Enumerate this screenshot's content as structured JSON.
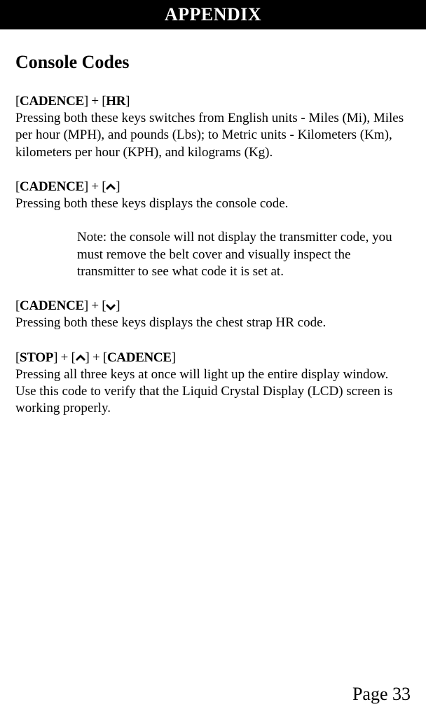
{
  "header": "APPENDIX",
  "sectionTitle": "Console Codes",
  "combos": [
    {
      "parts": [
        "[",
        "CADENCE",
        "] + [",
        "HR",
        "]"
      ],
      "boldIdx": [
        1,
        3
      ],
      "text": "Pressing both these keys switches from English units - Miles (Mi), Miles per hour (MPH), and pounds (Lbs); to Metric units - Kilometers (Km),  kilometers per hour (KPH), and kilograms (Kg)."
    },
    {
      "parts": [
        "[",
        "CADENCE",
        "] + [",
        "^",
        "]"
      ],
      "boldIdx": [
        1
      ],
      "arrowIdx": 3,
      "arrowDir": "up",
      "text": "Pressing both these keys displays the console code.",
      "note": "Note: the console will not display the transmitter code, you must remove the belt cover and visually inspect the transmitter to see what code it is set at."
    },
    {
      "parts": [
        "[",
        "CADENCE",
        "] + [",
        "v",
        "]"
      ],
      "boldIdx": [
        1
      ],
      "arrowIdx": 3,
      "arrowDir": "down",
      "text": "Pressing both these keys displays the chest strap HR code."
    },
    {
      "parts": [
        "[",
        "STOP",
        "] + [",
        "^",
        "] + [",
        "CADENCE",
        "]"
      ],
      "boldIdx": [
        1,
        5
      ],
      "arrowIdx": 3,
      "arrowDir": "up",
      "text": "Pressing all three keys at once will light up the entire display window. Use this code to verify that the Liquid Crystal Display (LCD) screen is working properly."
    }
  ],
  "pageNumber": "Page 33"
}
